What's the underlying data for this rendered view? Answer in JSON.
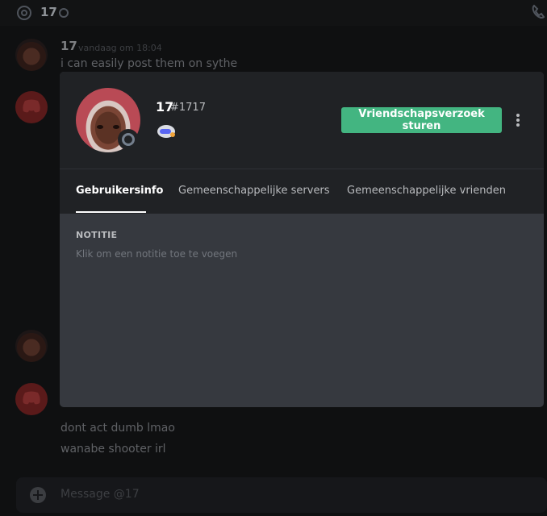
{
  "background": {
    "channel_name": "17",
    "messages": [
      {
        "author": "17",
        "timestamp": "vandaag om 18:04",
        "text": "i can easily post them on sythe"
      },
      {
        "text": "dont act dumb lmao"
      },
      {
        "text": "wanabe shooter irl"
      }
    ],
    "input_placeholder": "Message @17"
  },
  "profile": {
    "username": "17",
    "discriminator": "#1717",
    "status": "offline",
    "friend_request_label": "Vriendschapsverzoek sturen",
    "tabs": [
      {
        "label": "Gebruikersinfo",
        "active": true
      },
      {
        "label": "Gemeenschappelijke servers",
        "active": false
      },
      {
        "label": "Gemeenschappelijke vrienden",
        "active": false
      }
    ],
    "note_label": "NOTITIE",
    "note_placeholder": "Klik om een notitie toe te voegen"
  },
  "colors": {
    "accent_green": "#43b581",
    "modal_bg": "#36393f",
    "header_bg": "#202225"
  }
}
